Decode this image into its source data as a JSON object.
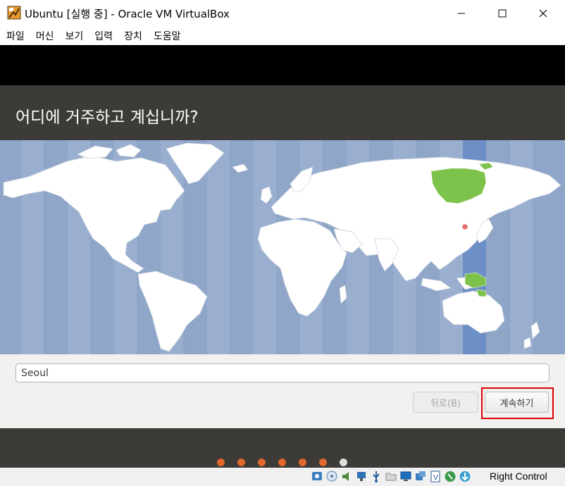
{
  "window": {
    "title": "Ubuntu [실행 중] - Oracle VM VirtualBox"
  },
  "menu": {
    "items": [
      {
        "label": "파일"
      },
      {
        "label": "머신"
      },
      {
        "label": "보기"
      },
      {
        "label": "입력"
      },
      {
        "label": "장치"
      },
      {
        "label": "도움말"
      }
    ]
  },
  "installer": {
    "title": "어디에 거주하고 계십니까?",
    "timezone_value": "Seoul",
    "back_label": "뒤로(B)",
    "continue_label": "계속하기",
    "progress": {
      "total_steps": 7,
      "current_step": 7
    }
  },
  "colors": {
    "header_bg": "#3c3b37",
    "ocean": "#8fa6c9",
    "land": "#ffffff",
    "selected_region": "#7dc24b",
    "selected_band": "#6d8fc7",
    "step_dot": "#e0672d",
    "highlight": "#e00000"
  },
  "statusbar": {
    "icons": [
      "hard-disk-icon",
      "optical-drive-icon",
      "audio-icon",
      "network-icon",
      "usb-icon",
      "shared-folder-icon",
      "display-icon",
      "capture-icon",
      "video-capture-icon",
      "mouse-integration-icon",
      "keyboard-capture-icon"
    ],
    "host_key": "Right Control"
  }
}
